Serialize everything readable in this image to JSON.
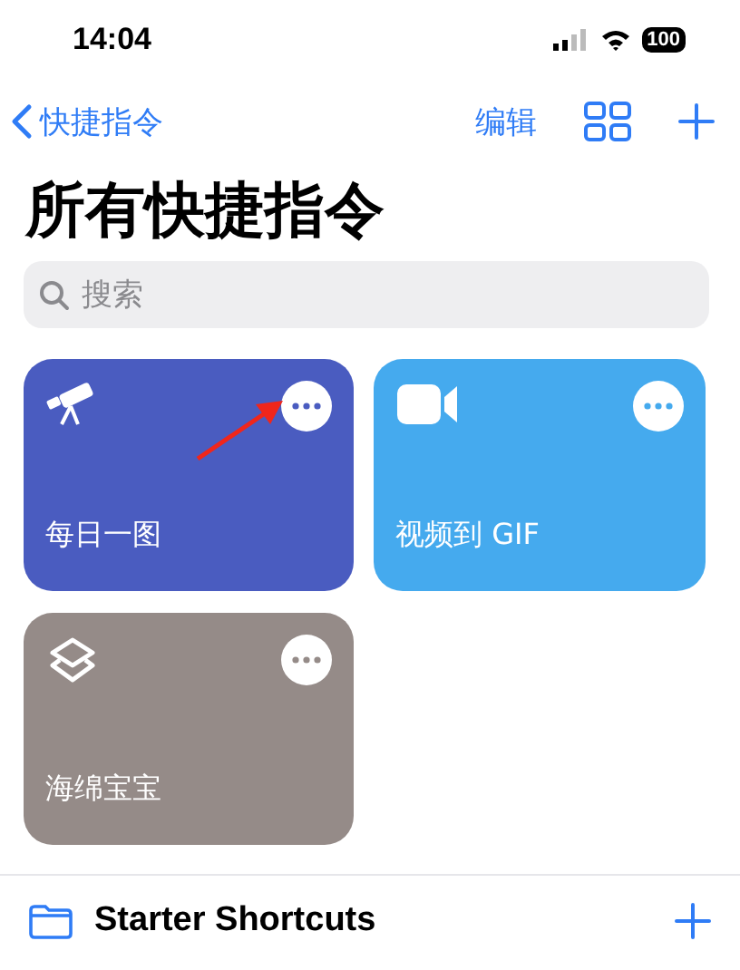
{
  "status_bar": {
    "time": "14:04",
    "battery": "100"
  },
  "nav": {
    "back": "快捷指令",
    "edit": "编辑"
  },
  "title": "所有快捷指令",
  "search": {
    "placeholder": "搜索"
  },
  "shortcuts": [
    {
      "name": "每日一图",
      "kind": "telescope",
      "color": "#4a5cc0",
      "highlighted": true
    },
    {
      "name": "视频到 GIF",
      "kind": "video",
      "color": "#45aaee",
      "highlighted": false
    },
    {
      "name": "海绵宝宝",
      "kind": "layers",
      "color": "#958b88",
      "highlighted": false
    }
  ],
  "folder": {
    "name": "Starter Shortcuts"
  }
}
